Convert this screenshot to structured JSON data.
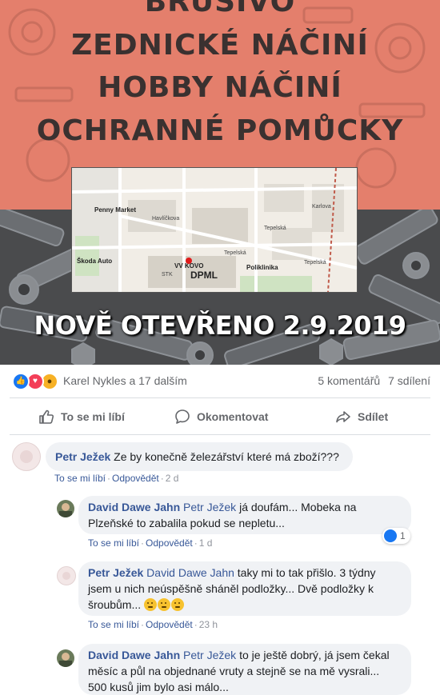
{
  "post_image": {
    "headline_lines": [
      "BRUSIVO",
      "ZEDNICKÉ NÁČINÍ",
      "HOBBY NÁČINÍ",
      "OCHRANNÉ POMŮCKY"
    ],
    "opening_text": "NOVĚ OTEVŘENO 2.9.2019",
    "map_labels": {
      "penny": "Penny Market",
      "skoda": "Škoda Auto",
      "vv_kovo": "VV KOVO",
      "stk": "STK",
      "dpml": "DPML",
      "poliklinika": "Poliklinika",
      "street_a": "Tepelská",
      "street_b": "Tepelská",
      "street_c": "Tepelská",
      "street_d": "Havlíčkova",
      "street_e": "Karlova"
    }
  },
  "reactions": {
    "names": "Karel Nykles a 17 dalším",
    "comments_count": "5 komentářů",
    "shares_count": "7 sdílení"
  },
  "actions": {
    "like": "To se mi líbí",
    "comment": "Okomentovat",
    "share": "Sdílet"
  },
  "comments": [
    {
      "author": "Petr Ježek",
      "text": "Ze by konečně železářství které má zboží???",
      "like": "To se mi líbí",
      "reply": "Odpovědět",
      "time": "2 d"
    },
    {
      "author": "David Dawe Jahn",
      "mention": "Petr Ježek",
      "text_line1": " já doufám... Mobeka na",
      "text_line2": "Plzeňské to zabalila pokud se nepletu...",
      "like": "To se mi líbí",
      "reply": "Odpovědět",
      "time": "1 d",
      "reaction_count": "1"
    },
    {
      "author": "Petr Ježek",
      "mention": "David Dawe Jahn",
      "text_line1": " taky mi to tak přišlo. 3 týdny",
      "text_line2": "jsem u nich neúspěšně sháněl podložky... Dvě podložky k",
      "text_line3": "šroubům... ",
      "like": "To se mi líbí",
      "reply": "Odpovědět",
      "time": "23 h"
    },
    {
      "author": "David Dawe Jahn",
      "mention": "Petr Ježek",
      "text_line1": " to je ještě dobrý, já jsem čekal",
      "text_line2": "měsíc a půl na objednané vruty a stejně se na mě vysrali...",
      "text_line3": "500 kusů jim bylo asi málo..."
    }
  ],
  "colors": {
    "salmon": "#e47f6c",
    "link_blue": "#385898",
    "like_blue": "#1877f2"
  }
}
